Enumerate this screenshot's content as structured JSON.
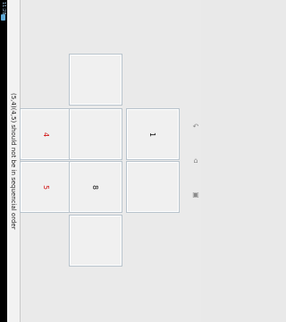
{
  "status_bar": {
    "time": "11:28"
  },
  "title": "(5,4)(4,5) should not be in sequencial order",
  "tiles": [
    {
      "id": "top",
      "label": ""
    },
    {
      "id": "r1c1",
      "label": "4",
      "color": "#d01010"
    },
    {
      "id": "r1c2",
      "label": ""
    },
    {
      "id": "r1c3",
      "label": "1",
      "color": "#111111"
    },
    {
      "id": "r2c1",
      "label": "5",
      "color": "#d01010"
    },
    {
      "id": "r2c2",
      "label": "8",
      "color": "#111111"
    },
    {
      "id": "r2c3",
      "label": ""
    },
    {
      "id": "bottom",
      "label": ""
    }
  ],
  "nav": {
    "icons": [
      "back-icon",
      "home-icon",
      "recent-apps-icon"
    ]
  }
}
